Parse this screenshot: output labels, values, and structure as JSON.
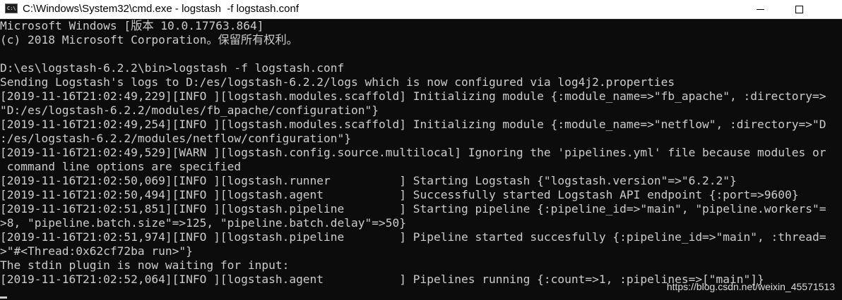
{
  "window": {
    "title": "C:\\Windows\\System32\\cmd.exe - logstash  -f logstash.conf",
    "icon": "cmd-icon",
    "icon_label": "C:\\",
    "controls": [
      "minimize-icon",
      "maximize-icon"
    ]
  },
  "console": {
    "lines": [
      "Microsoft Windows [版本 10.0.17763.864]",
      "(c) 2018 Microsoft Corporation。保留所有权利。",
      "",
      "D:\\es\\logstash-6.2.2\\bin>logstash -f logstash.conf",
      "Sending Logstash's logs to D:/es/logstash-6.2.2/logs which is now configured via log4j2.properties",
      "[2019-11-16T21:02:49,229][INFO ][logstash.modules.scaffold] Initializing module {:module_name=>\"fb_apache\", :directory=>",
      "\"D:/es/logstash-6.2.2/modules/fb_apache/configuration\"}",
      "[2019-11-16T21:02:49,254][INFO ][logstash.modules.scaffold] Initializing module {:module_name=>\"netflow\", :directory=>\"D",
      ":/es/logstash-6.2.2/modules/netflow/configuration\"}",
      "[2019-11-16T21:02:49,529][WARN ][logstash.config.source.multilocal] Ignoring the 'pipelines.yml' file because modules or",
      " command line options are specified",
      "[2019-11-16T21:02:50,069][INFO ][logstash.runner          ] Starting Logstash {\"logstash.version\"=>\"6.2.2\"}",
      "[2019-11-16T21:02:50,494][INFO ][logstash.agent           ] Successfully started Logstash API endpoint {:port=>9600}",
      "[2019-11-16T21:02:51,851][INFO ][logstash.pipeline        ] Starting pipeline {:pipeline_id=>\"main\", \"pipeline.workers\"=",
      ">8, \"pipeline.batch.size\"=>125, \"pipeline.batch.delay\"=>50}",
      "[2019-11-16T21:02:51,974][INFO ][logstash.pipeline        ] Pipeline started succesfully {:pipeline_id=>\"main\", :thread=",
      ">\"#<Thread:0x62cf72ba run>\"}",
      "The stdin plugin is now waiting for input:",
      "[2019-11-16T21:02:52,064][INFO ][logstash.agent           ] Pipelines running {:count=>1, :pipelines=>[\"main\"]}"
    ]
  },
  "watermark": "https://blog.csdn.net/weixin_45571513",
  "colors": {
    "console_bg": "#0c0c0c",
    "console_fg": "#cccccc",
    "titlebar_bg": "#ffffff"
  }
}
